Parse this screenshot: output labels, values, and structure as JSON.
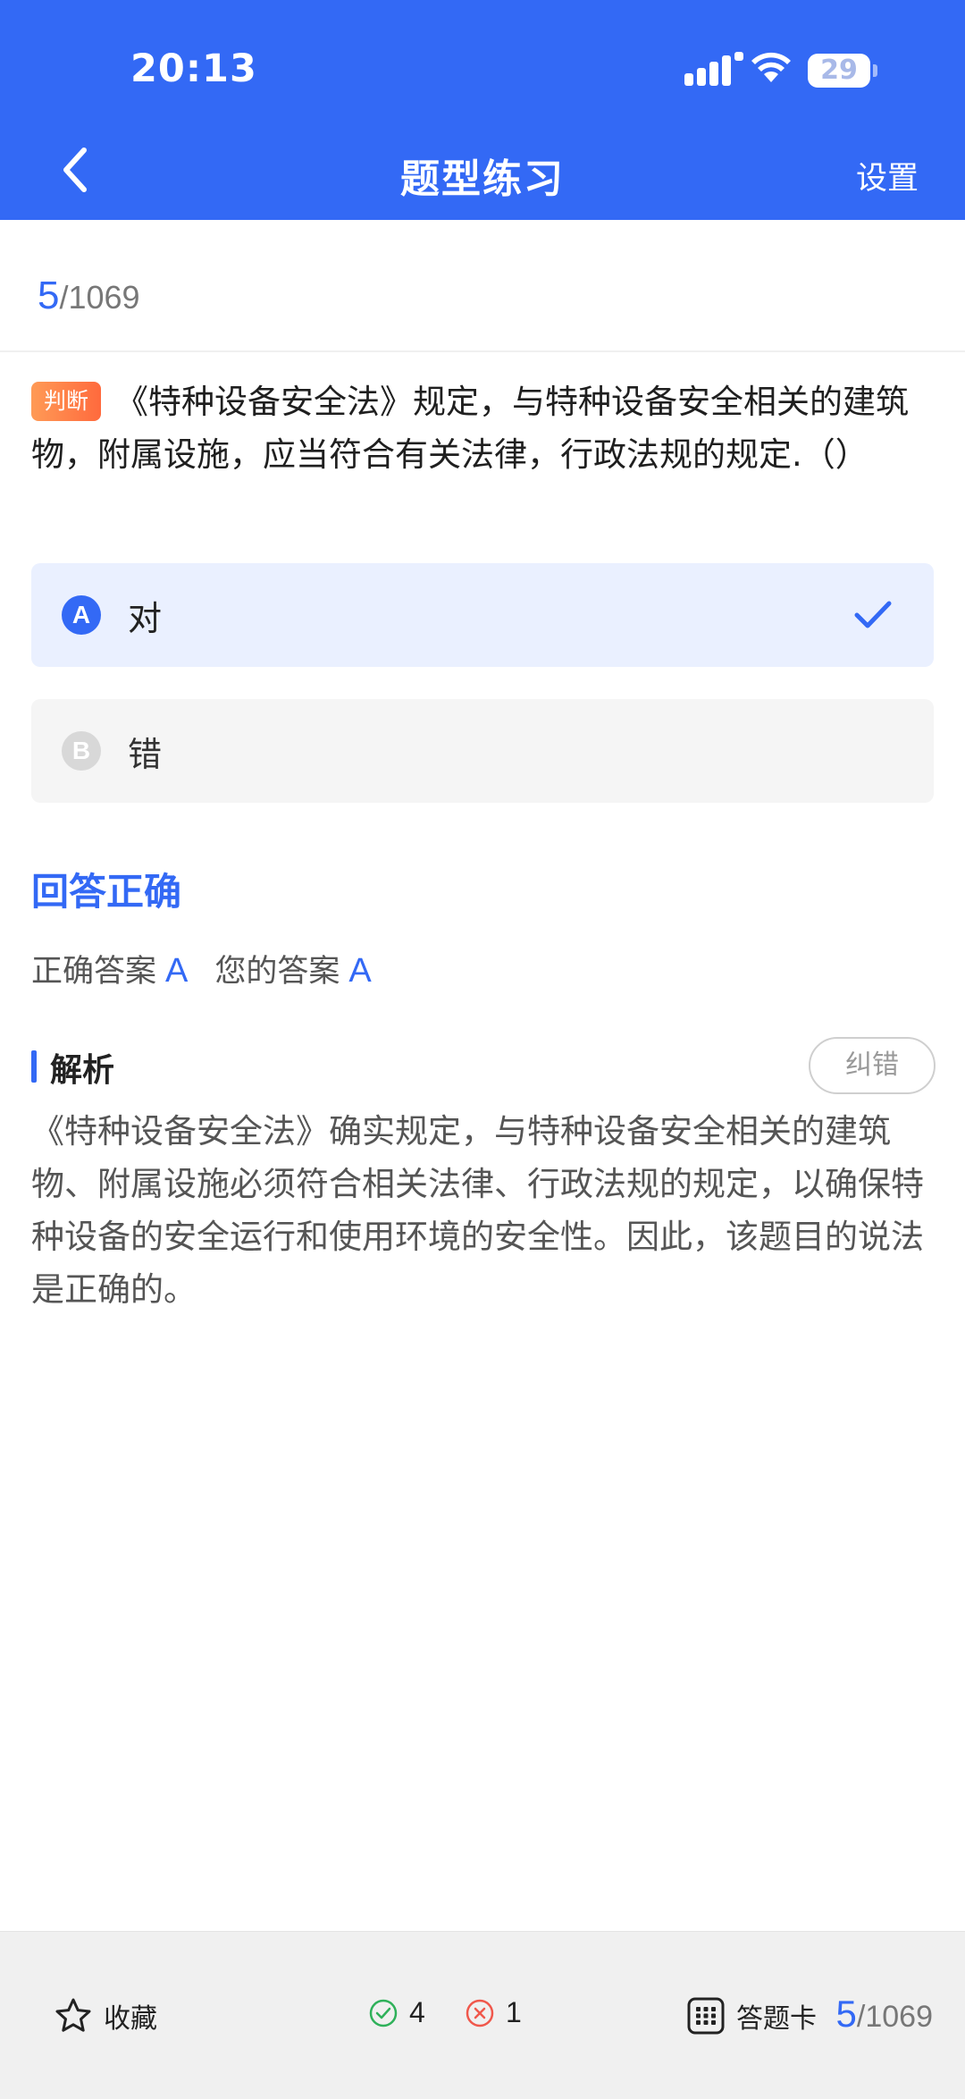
{
  "status_bar": {
    "time": "20:13",
    "battery": "29"
  },
  "nav": {
    "title": "题型练习",
    "settings_label": "设置"
  },
  "progress": {
    "current": "5",
    "total": "/1069"
  },
  "question": {
    "type_label": "判断",
    "text": "《特种设备安全法》规定，与特种设备安全相关的建筑物，附属设施，应当符合有关法律，行政法规的规定.（）"
  },
  "options": [
    {
      "letter": "A",
      "text": "对",
      "selected": true
    },
    {
      "letter": "B",
      "text": "错",
      "selected": false
    }
  ],
  "result": {
    "title": "回答正确",
    "correct_label": "正确答案",
    "correct_value": "A",
    "yours_label": "您的答案",
    "yours_value": "A"
  },
  "analysis": {
    "title": "解析",
    "report_label": "纠错",
    "text": "《特种设备安全法》确实规定，与特种设备安全相关的建筑物、附属设施必须符合相关法律、行政法规的规定，以确保特种设备的安全运行和使用环境的安全性。因此，该题目的说法是正确的。"
  },
  "bottom_bar": {
    "favorite_label": "收藏",
    "right_count": "4",
    "wrong_count": "1",
    "card_label": "答题卡",
    "current": "5",
    "total": "/1069"
  },
  "colors": {
    "primary": "#3369f5",
    "right": "#2fb15a",
    "wrong": "#f0584c",
    "tag": "#ff7a45"
  }
}
